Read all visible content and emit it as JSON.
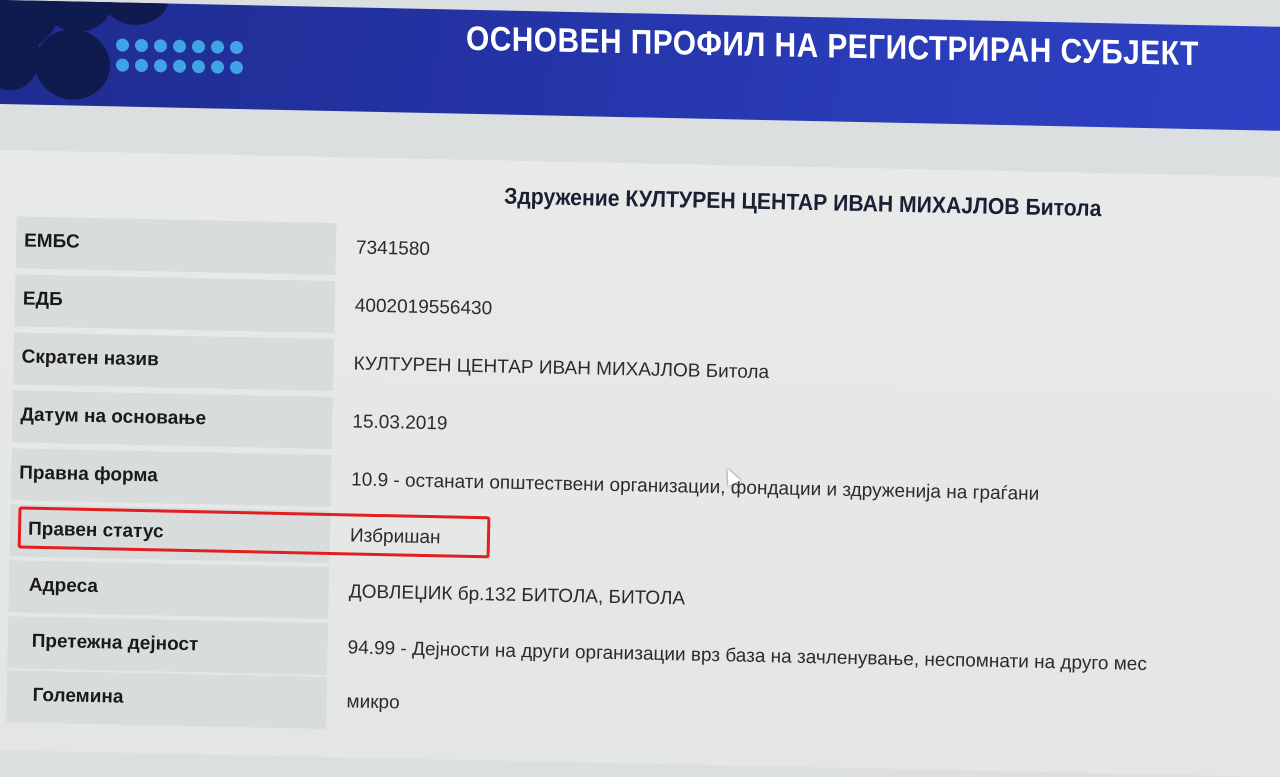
{
  "header": {
    "title": "ОСНОВЕН ПРОФИЛ НА РЕГИСТРИРАН СУБЈЕКТ"
  },
  "entity": {
    "name": "Здружение КУЛТУРЕН ЦЕНТАР ИВАН МИХАЈЛОВ Битола"
  },
  "fields": [
    {
      "label": "ЕМБС",
      "value": "7341580"
    },
    {
      "label": "ЕДБ",
      "value": "4002019556430"
    },
    {
      "label": "Скратен назив",
      "value": "КУЛТУРЕН ЦЕНТАР ИВАН МИХАЈЛОВ Битола"
    },
    {
      "label": "Датум на основање",
      "value": "15.03.2019"
    },
    {
      "label": "Правна форма",
      "value": "10.9 - останати општествени организации, фондации и здруженија на граѓани"
    },
    {
      "label": "Правен статус",
      "value": "Избришан"
    },
    {
      "label": "Адреса",
      "value": "ДОВЛЕЏИК бр.132 БИТОЛА, БИТОЛА"
    },
    {
      "label": "Претежна дејност",
      "value": "94.99 - Дејности на други организации врз база на зачленување, неспомнати на друго мес"
    },
    {
      "label": "Големина",
      "value": "микро"
    }
  ],
  "highlight_color": "#e02020",
  "banner_color": "#2433a6",
  "icons": [
    "logo-icon",
    "mouse-cursor-icon"
  ]
}
